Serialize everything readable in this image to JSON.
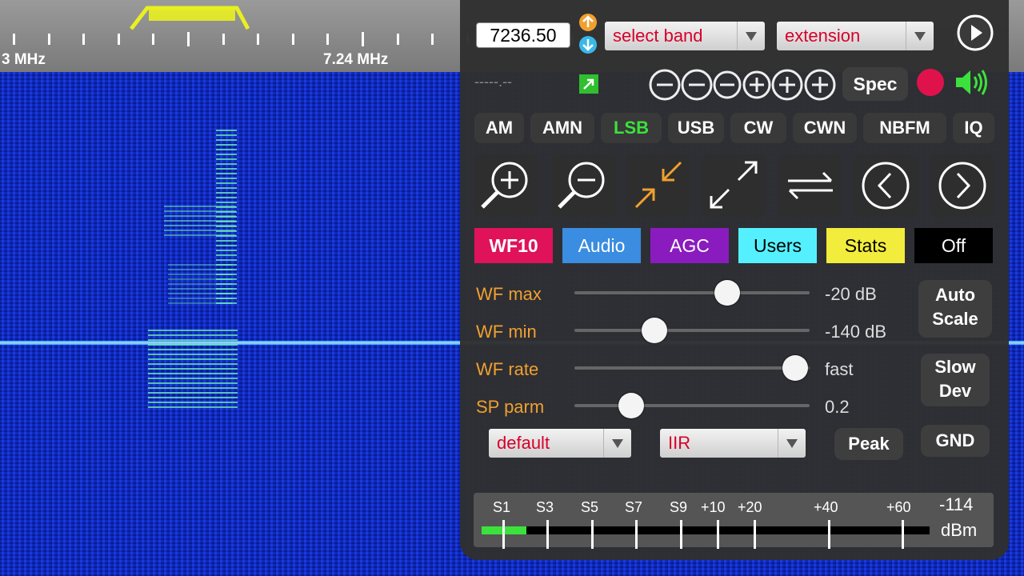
{
  "scale": {
    "labels": {
      "left": "3 MHz",
      "mid": "7.24 MHz"
    }
  },
  "controls": {
    "frequency": "7236.50",
    "band_select": "select band",
    "extension_select": "extension",
    "status_text": "-----.--",
    "spec_label": "Spec"
  },
  "modes": [
    "AM",
    "AMN",
    "LSB",
    "USB",
    "CW",
    "CWN",
    "NBFM",
    "IQ"
  ],
  "active_mode": "LSB",
  "tabs": [
    {
      "label": "WF10",
      "bg": "#e0125a",
      "fg": "#ffffff"
    },
    {
      "label": "Audio",
      "bg": "#3a8de0",
      "fg": "#ffffff"
    },
    {
      "label": "AGC",
      "bg": "#8a1cbf",
      "fg": "#ffffff"
    },
    {
      "label": "Users",
      "bg": "#55f0ff",
      "fg": "#000000"
    },
    {
      "label": "Stats",
      "bg": "#f2ec3c",
      "fg": "#000000"
    },
    {
      "label": "Off",
      "bg": "#000000",
      "fg": "#ffffff"
    }
  ],
  "sliders": [
    {
      "label": "WF max",
      "value_text": "-20 dB",
      "level": 0.65
    },
    {
      "label": "WF min",
      "value_text": "-140 dB",
      "level": 0.34
    },
    {
      "label": "WF rate",
      "value_text": "fast",
      "level": 0.94
    },
    {
      "label": "SP parm",
      "value_text": "0.2",
      "level": 0.24
    }
  ],
  "side_buttons": {
    "auto_scale": "Auto\nScale",
    "slow_dev": "Slow\nDev",
    "peak": "Peak",
    "gnd": "GND"
  },
  "selects": {
    "window": "default",
    "filter": "IIR"
  },
  "smeter": {
    "labels": [
      "S1",
      "S3",
      "S5",
      "S7",
      "S9",
      "+10",
      "+20",
      "+40",
      "+60"
    ],
    "value": "-114",
    "unit": "dBm",
    "level": 0.1
  },
  "colors": {
    "accent_orange": "#f0a030",
    "active_mode": "#3be23b",
    "passband": "#e8f020",
    "record": "#e0124c",
    "speaker": "#3be23b",
    "select_text": "#d7002a"
  }
}
